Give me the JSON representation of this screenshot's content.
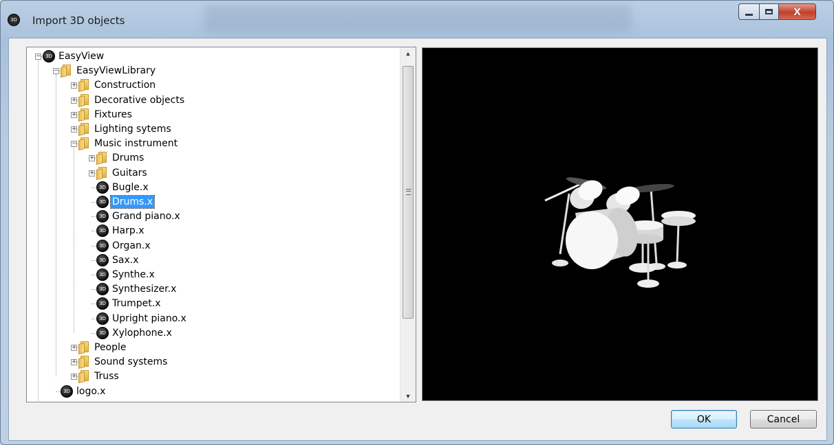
{
  "window": {
    "title": "Import 3D objects",
    "icon": "easyview-logo-icon",
    "controls": {
      "minimize": "minimize-icon",
      "maximize": "maximize-icon",
      "close_label": "X"
    }
  },
  "tree": {
    "root": {
      "label": "EasyView",
      "expanded": true
    },
    "library": {
      "label": "EasyViewLibrary",
      "expanded": true
    },
    "categories": [
      {
        "label": "Construction",
        "expanded": false
      },
      {
        "label": "Decorative objects",
        "expanded": false
      },
      {
        "label": "Fixtures",
        "expanded": false
      },
      {
        "label": "Lighting sytems",
        "expanded": false
      },
      {
        "label": "Music instrument",
        "expanded": true
      }
    ],
    "music_subfolders": [
      {
        "label": "Drums",
        "expanded": false
      },
      {
        "label": "Guitars",
        "expanded": false
      }
    ],
    "music_files": [
      {
        "label": "Bugle.x"
      },
      {
        "label": "Drums.x",
        "selected": true
      },
      {
        "label": "Grand piano.x"
      },
      {
        "label": "Harp.x"
      },
      {
        "label": "Organ.x"
      },
      {
        "label": "Sax.x"
      },
      {
        "label": "Synthe.x"
      },
      {
        "label": "Synthesizer.x"
      },
      {
        "label": "Trumpet.x"
      },
      {
        "label": "Upright piano.x"
      },
      {
        "label": "Xylophone.x"
      }
    ],
    "more_categories": [
      {
        "label": "People",
        "expanded": false
      },
      {
        "label": "Sound systems",
        "expanded": false
      },
      {
        "label": "Truss",
        "expanded": false
      }
    ],
    "root_file": {
      "label": "logo.x"
    },
    "expander_collapsed": "+",
    "expander_expanded": "−"
  },
  "preview": {
    "background": "#000000",
    "model": "drum kit 3D preview"
  },
  "buttons": {
    "ok": "OK",
    "cancel": "Cancel"
  },
  "colors": {
    "selection": "#3399ff",
    "preview_bg": "#000000"
  }
}
